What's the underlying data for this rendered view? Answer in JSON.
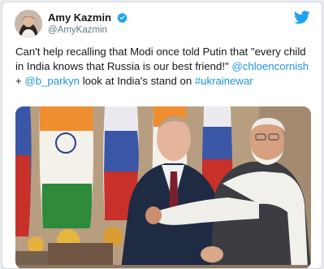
{
  "author": {
    "name": "Amy Kazmin",
    "handle": "@AmyKazmin"
  },
  "tweet": {
    "text_before": "Can't help recalling that Modi once told Putin that \"every child in India knows that Russia is our best friend!\"",
    "mention_1": "@chloencornish",
    "joiner": "+",
    "mention_2": "@b_parkyn",
    "text_after": "look at India's stand on",
    "hashtag": "#ukrainewar"
  },
  "colors": {
    "link": "#1b95e0",
    "verified_badge": "#1da1f2",
    "twitter_bird": "#1da1f2",
    "text": "#14171a",
    "handle": "#657786"
  },
  "icons": {
    "verified": "verified-badge-icon",
    "twitter": "twitter-bird-icon"
  }
}
